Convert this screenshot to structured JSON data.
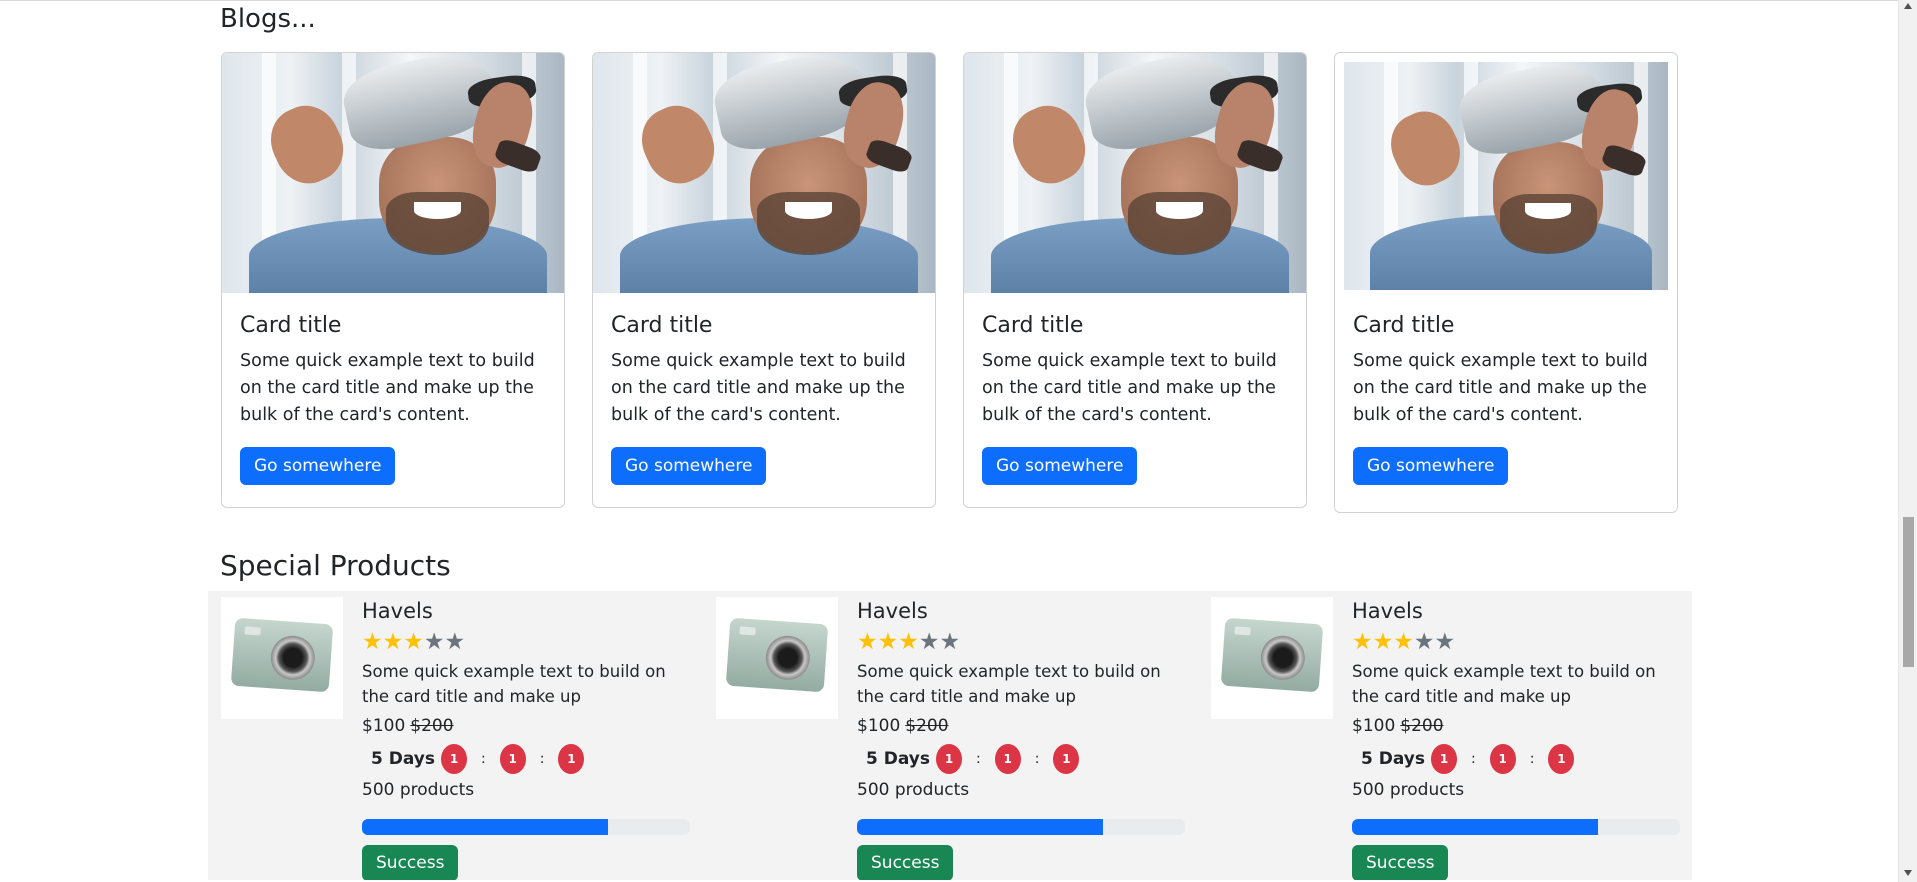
{
  "blogs": {
    "heading": "Blogs...",
    "cards": [
      {
        "title": "Card title",
        "text": "Some quick example text to build on the card title and make up the bulk of the card's content.",
        "button": "Go somewhere"
      },
      {
        "title": "Card title",
        "text": "Some quick example text to build on the card title and make up the bulk of the card's content.",
        "button": "Go somewhere"
      },
      {
        "title": "Card title",
        "text": "Some quick example text to build on the card title and make up the bulk of the card's content.",
        "button": "Go somewhere"
      },
      {
        "title": "Card title",
        "text": "Some quick example text to build on the card title and make up the bulk of the card's content.",
        "button": "Go somewhere"
      }
    ]
  },
  "special": {
    "heading": "Special Products",
    "products": [
      {
        "name": "Havels",
        "rating": 3,
        "max_rating": 5,
        "description": "Some quick example text to build on the card title and make up",
        "price": "$100",
        "old_price": "$200",
        "days": "5 Days",
        "hours": "1",
        "minutes": "1",
        "seconds": "1",
        "count": "500 products",
        "progress_percent": 75,
        "button": "Success"
      },
      {
        "name": "Havels",
        "rating": 3,
        "max_rating": 5,
        "description": "Some quick example text to build on the card title and make up",
        "price": "$100",
        "old_price": "$200",
        "days": "5 Days",
        "hours": "1",
        "minutes": "1",
        "seconds": "1",
        "count": "500 products",
        "progress_percent": 75,
        "button": "Success"
      },
      {
        "name": "Havels",
        "rating": 3,
        "max_rating": 5,
        "description": "Some quick example text to build on the card title and make up",
        "price": "$100",
        "old_price": "$200",
        "days": "5 Days",
        "hours": "1",
        "minutes": "1",
        "seconds": "1",
        "count": "500 products",
        "progress_percent": 75,
        "button": "Success"
      }
    ]
  },
  "colors": {
    "primary": "#0d6efd",
    "success": "#198754",
    "danger": "#dc3545",
    "star": "#ffc107",
    "star_off": "#6c757d",
    "band_bg": "#f3f3f3"
  },
  "icons": {
    "blog_image": "vr-headset-photo",
    "product_image": "camera-photo",
    "rating": "star-icon"
  }
}
